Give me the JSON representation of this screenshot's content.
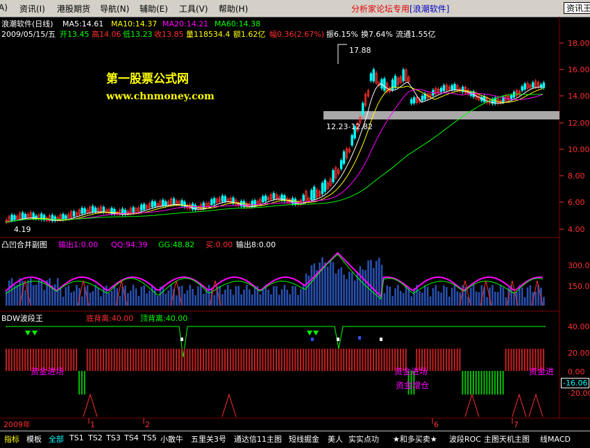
{
  "menu": {
    "items": [
      "A)",
      "资讯(I)",
      "港股期货",
      "导航(N)",
      "辅助(E)",
      "工具(V)",
      "帮助(H)"
    ],
    "forum_link_text": "分析家论坛专用",
    "forum_link_brand": "[浪潮软件]",
    "info_button": "资讯王"
  },
  "main_panel": {
    "title": "浪潮软件(日线)",
    "ma5": "MA5:14.61",
    "ma10": "MA10:14.37",
    "ma20": "MA20:14.21",
    "ma60": "MA60:14.38",
    "date": "2009/05/15/五",
    "open": "开13.45",
    "high": "高14.06",
    "low": "低13.23",
    "close": "收13.85",
    "volume": "量118534.4",
    "amount": "额1.62亿",
    "change": "幅0.36(2.67%)",
    "amplitude": "振6.15%",
    "turnover": "换7.64%",
    "float": "流通1.55亿",
    "watermark_cn": "第一股票公式网",
    "watermark_url": "www.chnmoney.com",
    "peak_label": "17.88",
    "low_label": "4.19",
    "range_label": "12.23-12.82",
    "y_ticks": [
      "18.00",
      "16.00",
      "14.00",
      "12.00",
      "10.00",
      "8.00",
      "6.00",
      "4.00"
    ]
  },
  "sub_panel_1": {
    "title": "凸凹合并副图",
    "out1": "输出1:0.00",
    "qq": "QQ:94.39",
    "gg": "GG:48.82",
    "buy": "买:0.00",
    "out8": "输出8:0.00",
    "y_ticks": [
      "300.0",
      "150.0"
    ]
  },
  "sub_panel_2": {
    "title": "BDW波段王",
    "bottom_div": "底背离:40.00",
    "top_div": "顶背离:40.00",
    "y_ticks": [
      "40.00",
      "20.00",
      "0.00",
      "-20.00"
    ],
    "value_box": "-16.06",
    "text_fund_in_1": "资金进场",
    "text_fund_in_2": "资金进场",
    "text_fund_add": "资金增仓",
    "text_fund_in_3": "资金进"
  },
  "time_axis": {
    "year": "2009年",
    "months": [
      "1",
      "2",
      "6",
      "7"
    ]
  },
  "period": "日线",
  "tabs": [
    "指标",
    "模板",
    "全部",
    "TS1",
    "TS2",
    "TS3",
    "TS4",
    "TS5",
    "小散牛",
    "五里关3号",
    "通达信11主图",
    "短线掘金",
    "美人",
    "实实点功",
    "★和多买卖★",
    "波段ROC",
    "主图天机主图",
    "线MACD"
  ],
  "colors": {
    "up": "#ff3030",
    "down": "#00ffff",
    "ma5": "#ffffff",
    "ma10": "#ffff00",
    "ma20": "#ff00ff",
    "ma60": "#00ff00",
    "grid": "#800000",
    "watermark": "#ffff00"
  }
}
